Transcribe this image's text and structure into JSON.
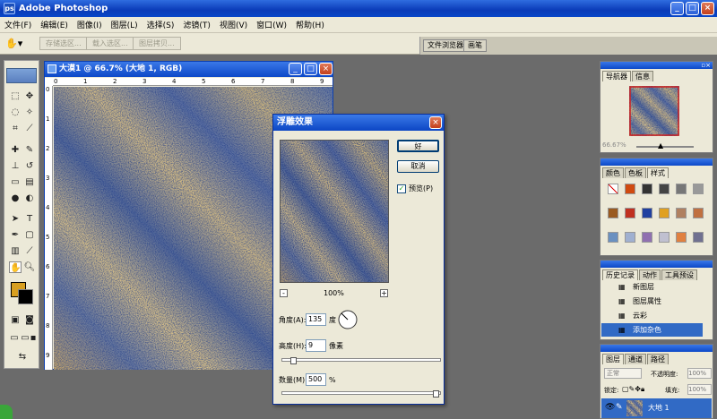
{
  "app": {
    "title": "Adobe Photoshop",
    "icon": "photoshop-icon"
  },
  "window_controls": {
    "min": "_",
    "max": "□",
    "close": "×"
  },
  "menu": [
    "文件(F)",
    "编辑(E)",
    "图像(I)",
    "图层(L)",
    "选择(S)",
    "滤镜(T)",
    "视图(V)",
    "窗口(W)",
    "帮助(H)"
  ],
  "options_bar": {
    "buttons": [
      "存储选区...",
      "载入选区...",
      "图层拷贝..."
    ],
    "well_tabs": [
      "文件浏览器",
      "画笔"
    ]
  },
  "document": {
    "title": "大漠1 @ 66.7% (大地 1, RGB)",
    "ruler_h": [
      "0",
      "1",
      "2",
      "3",
      "4",
      "5",
      "6",
      "7",
      "8",
      "9"
    ],
    "ruler_v": [
      "0",
      "1",
      "2",
      "3",
      "4",
      "5",
      "6",
      "7",
      "8",
      "9"
    ]
  },
  "colors": {
    "foreground": "#d89f20",
    "background": "#000000",
    "accent_blue": "#0c48c8",
    "selected": "#316ac5"
  },
  "navigator": {
    "tabs": [
      "导航器",
      "信息"
    ],
    "zoom": "66.67%"
  },
  "color_panel": {
    "tabs": [
      "颜色",
      "色板",
      "样式"
    ]
  },
  "history": {
    "tabs": [
      "历史记录",
      "动作",
      "工具预设"
    ],
    "items": [
      "新图层",
      "图层属性",
      "云彩",
      "添加杂色"
    ],
    "selected_index": 3
  },
  "layers": {
    "tabs": [
      "图层",
      "通道",
      "路径"
    ],
    "blend_mode": "正常",
    "opacity_label": "不透明度:",
    "opacity": "100%",
    "lock_label": "锁定:",
    "fill_label": "填充:",
    "fill": "100%",
    "layer_name": "大地 1"
  },
  "dialog": {
    "title": "浮雕效果",
    "ok": "好",
    "cancel": "取消",
    "preview_label": "预览(P)",
    "preview_checked": true,
    "zoom": "100%",
    "zoom_minus": "-",
    "zoom_plus": "+",
    "angle_label": "角度(A):",
    "angle_value": "135",
    "angle_unit": "度",
    "height_label": "高度(H):",
    "height_value": "9",
    "height_unit": "像素",
    "amount_label": "数量(M):",
    "amount_value": "500",
    "amount_unit": "%"
  }
}
